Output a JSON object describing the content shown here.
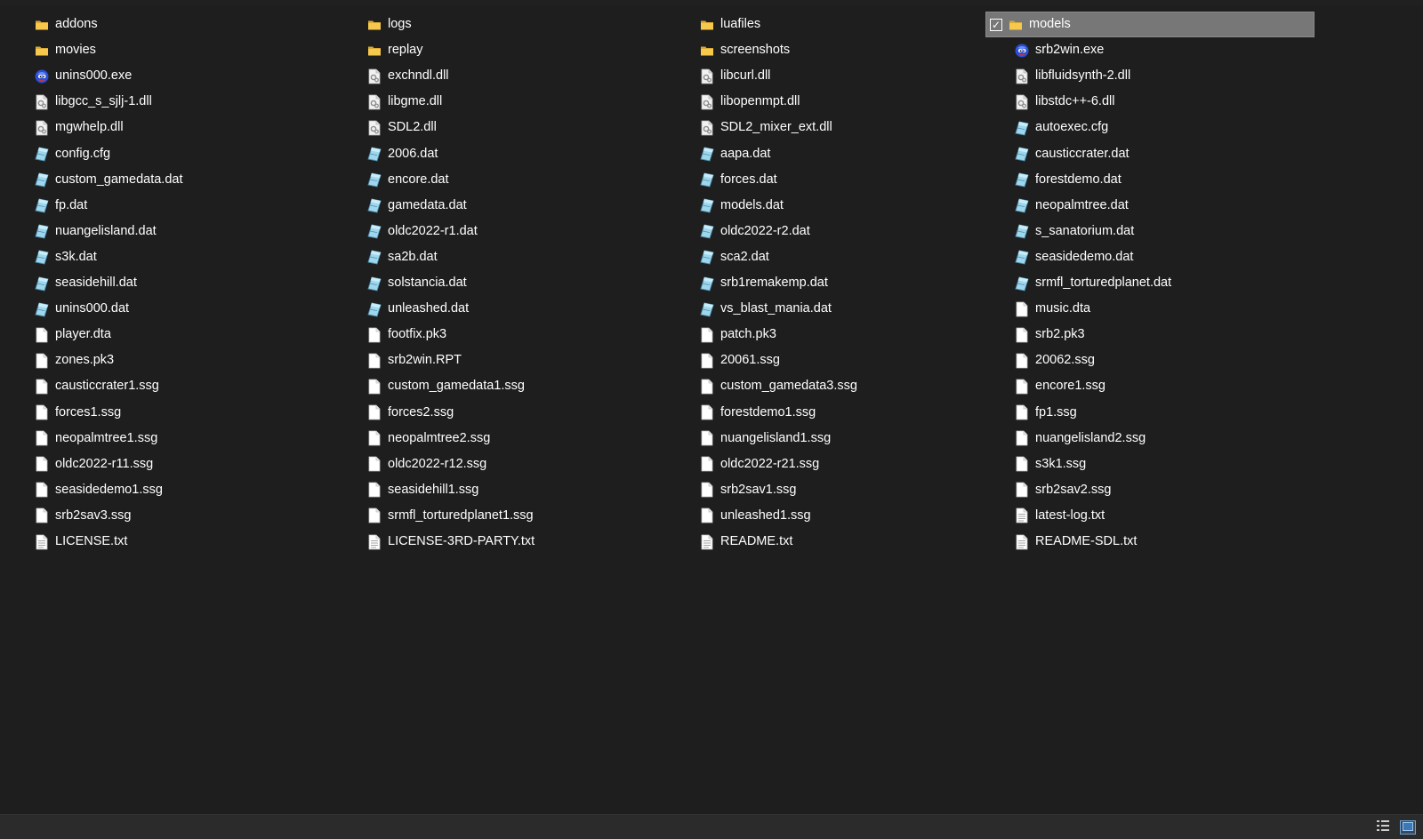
{
  "columns": [
    {
      "items": [
        {
          "name": "addons",
          "type": "folder"
        },
        {
          "name": "movies",
          "type": "folder"
        },
        {
          "name": "unins000.exe",
          "type": "exe"
        },
        {
          "name": "libgcc_s_sjlj-1.dll",
          "type": "dll"
        },
        {
          "name": "mgwhelp.dll",
          "type": "dll"
        },
        {
          "name": "config.cfg",
          "type": "config"
        },
        {
          "name": "custom_gamedata.dat",
          "type": "config"
        },
        {
          "name": "fp.dat",
          "type": "config"
        },
        {
          "name": "nuangelisland.dat",
          "type": "config"
        },
        {
          "name": "s3k.dat",
          "type": "config"
        },
        {
          "name": "seasidehill.dat",
          "type": "config"
        },
        {
          "name": "unins000.dat",
          "type": "config"
        },
        {
          "name": "player.dta",
          "type": "file"
        },
        {
          "name": "zones.pk3",
          "type": "file"
        },
        {
          "name": "causticcrater1.ssg",
          "type": "file"
        },
        {
          "name": "forces1.ssg",
          "type": "file"
        },
        {
          "name": "neopalmtree1.ssg",
          "type": "file"
        },
        {
          "name": "oldc2022-r11.ssg",
          "type": "file"
        },
        {
          "name": "seasidedemo1.ssg",
          "type": "file"
        },
        {
          "name": "srb2sav3.ssg",
          "type": "file"
        },
        {
          "name": "LICENSE.txt",
          "type": "text"
        }
      ]
    },
    {
      "items": [
        {
          "name": "logs",
          "type": "folder"
        },
        {
          "name": "replay",
          "type": "folder"
        },
        {
          "name": "exchndl.dll",
          "type": "dll"
        },
        {
          "name": "libgme.dll",
          "type": "dll"
        },
        {
          "name": "SDL2.dll",
          "type": "dll"
        },
        {
          "name": "2006.dat",
          "type": "config"
        },
        {
          "name": "encore.dat",
          "type": "config"
        },
        {
          "name": "gamedata.dat",
          "type": "config"
        },
        {
          "name": "oldc2022-r1.dat",
          "type": "config"
        },
        {
          "name": "sa2b.dat",
          "type": "config"
        },
        {
          "name": "solstancia.dat",
          "type": "config"
        },
        {
          "name": "unleashed.dat",
          "type": "config"
        },
        {
          "name": "footfix.pk3",
          "type": "file"
        },
        {
          "name": "srb2win.RPT",
          "type": "file"
        },
        {
          "name": "custom_gamedata1.ssg",
          "type": "file"
        },
        {
          "name": "forces2.ssg",
          "type": "file"
        },
        {
          "name": "neopalmtree2.ssg",
          "type": "file"
        },
        {
          "name": "oldc2022-r12.ssg",
          "type": "file"
        },
        {
          "name": "seasidehill1.ssg",
          "type": "file"
        },
        {
          "name": "srmfl_torturedplanet1.ssg",
          "type": "file"
        },
        {
          "name": "LICENSE-3RD-PARTY.txt",
          "type": "text"
        }
      ]
    },
    {
      "items": [
        {
          "name": "luafiles",
          "type": "folder"
        },
        {
          "name": "screenshots",
          "type": "folder"
        },
        {
          "name": "libcurl.dll",
          "type": "dll"
        },
        {
          "name": "libopenmpt.dll",
          "type": "dll"
        },
        {
          "name": "SDL2_mixer_ext.dll",
          "type": "dll"
        },
        {
          "name": "aapa.dat",
          "type": "config"
        },
        {
          "name": "forces.dat",
          "type": "config"
        },
        {
          "name": "models.dat",
          "type": "config"
        },
        {
          "name": "oldc2022-r2.dat",
          "type": "config"
        },
        {
          "name": "sca2.dat",
          "type": "config"
        },
        {
          "name": "srb1remakemp.dat",
          "type": "config"
        },
        {
          "name": "vs_blast_mania.dat",
          "type": "config"
        },
        {
          "name": "patch.pk3",
          "type": "file"
        },
        {
          "name": "20061.ssg",
          "type": "file"
        },
        {
          "name": "custom_gamedata3.ssg",
          "type": "file"
        },
        {
          "name": "forestdemo1.ssg",
          "type": "file"
        },
        {
          "name": "nuangelisland1.ssg",
          "type": "file"
        },
        {
          "name": "oldc2022-r21.ssg",
          "type": "file"
        },
        {
          "name": "srb2sav1.ssg",
          "type": "file"
        },
        {
          "name": "unleashed1.ssg",
          "type": "file"
        },
        {
          "name": "README.txt",
          "type": "text"
        }
      ]
    },
    {
      "items": [
        {
          "name": "models",
          "type": "folder",
          "selected": true
        },
        {
          "name": "srb2win.exe",
          "type": "exe"
        },
        {
          "name": "libfluidsynth-2.dll",
          "type": "dll"
        },
        {
          "name": "libstdc++-6.dll",
          "type": "dll"
        },
        {
          "name": "autoexec.cfg",
          "type": "config"
        },
        {
          "name": "causticcrater.dat",
          "type": "config"
        },
        {
          "name": "forestdemo.dat",
          "type": "config"
        },
        {
          "name": "neopalmtree.dat",
          "type": "config"
        },
        {
          "name": "s_sanatorium.dat",
          "type": "config"
        },
        {
          "name": "seasidedemo.dat",
          "type": "config"
        },
        {
          "name": "srmfl_torturedplanet.dat",
          "type": "config"
        },
        {
          "name": "music.dta",
          "type": "file"
        },
        {
          "name": "srb2.pk3",
          "type": "file"
        },
        {
          "name": "20062.ssg",
          "type": "file"
        },
        {
          "name": "encore1.ssg",
          "type": "file"
        },
        {
          "name": "fp1.ssg",
          "type": "file"
        },
        {
          "name": "nuangelisland2.ssg",
          "type": "file"
        },
        {
          "name": "s3k1.ssg",
          "type": "file"
        },
        {
          "name": "srb2sav2.ssg",
          "type": "file"
        },
        {
          "name": "latest-log.txt",
          "type": "text"
        },
        {
          "name": "README-SDL.txt",
          "type": "text"
        }
      ]
    }
  ],
  "icons": {
    "folder": "folder-icon",
    "exe": "app-icon",
    "dll": "dll-icon",
    "config": "config-file-icon",
    "file": "blank-file-icon",
    "text": "text-file-icon"
  },
  "statusbar": {
    "view_details": "details-view-icon",
    "view_tiles": "large-icons-view-icon"
  },
  "colors": {
    "background": "#1e1e1e",
    "selection": "#777777",
    "text": "#ffffff",
    "folder": "#f3c24a"
  }
}
